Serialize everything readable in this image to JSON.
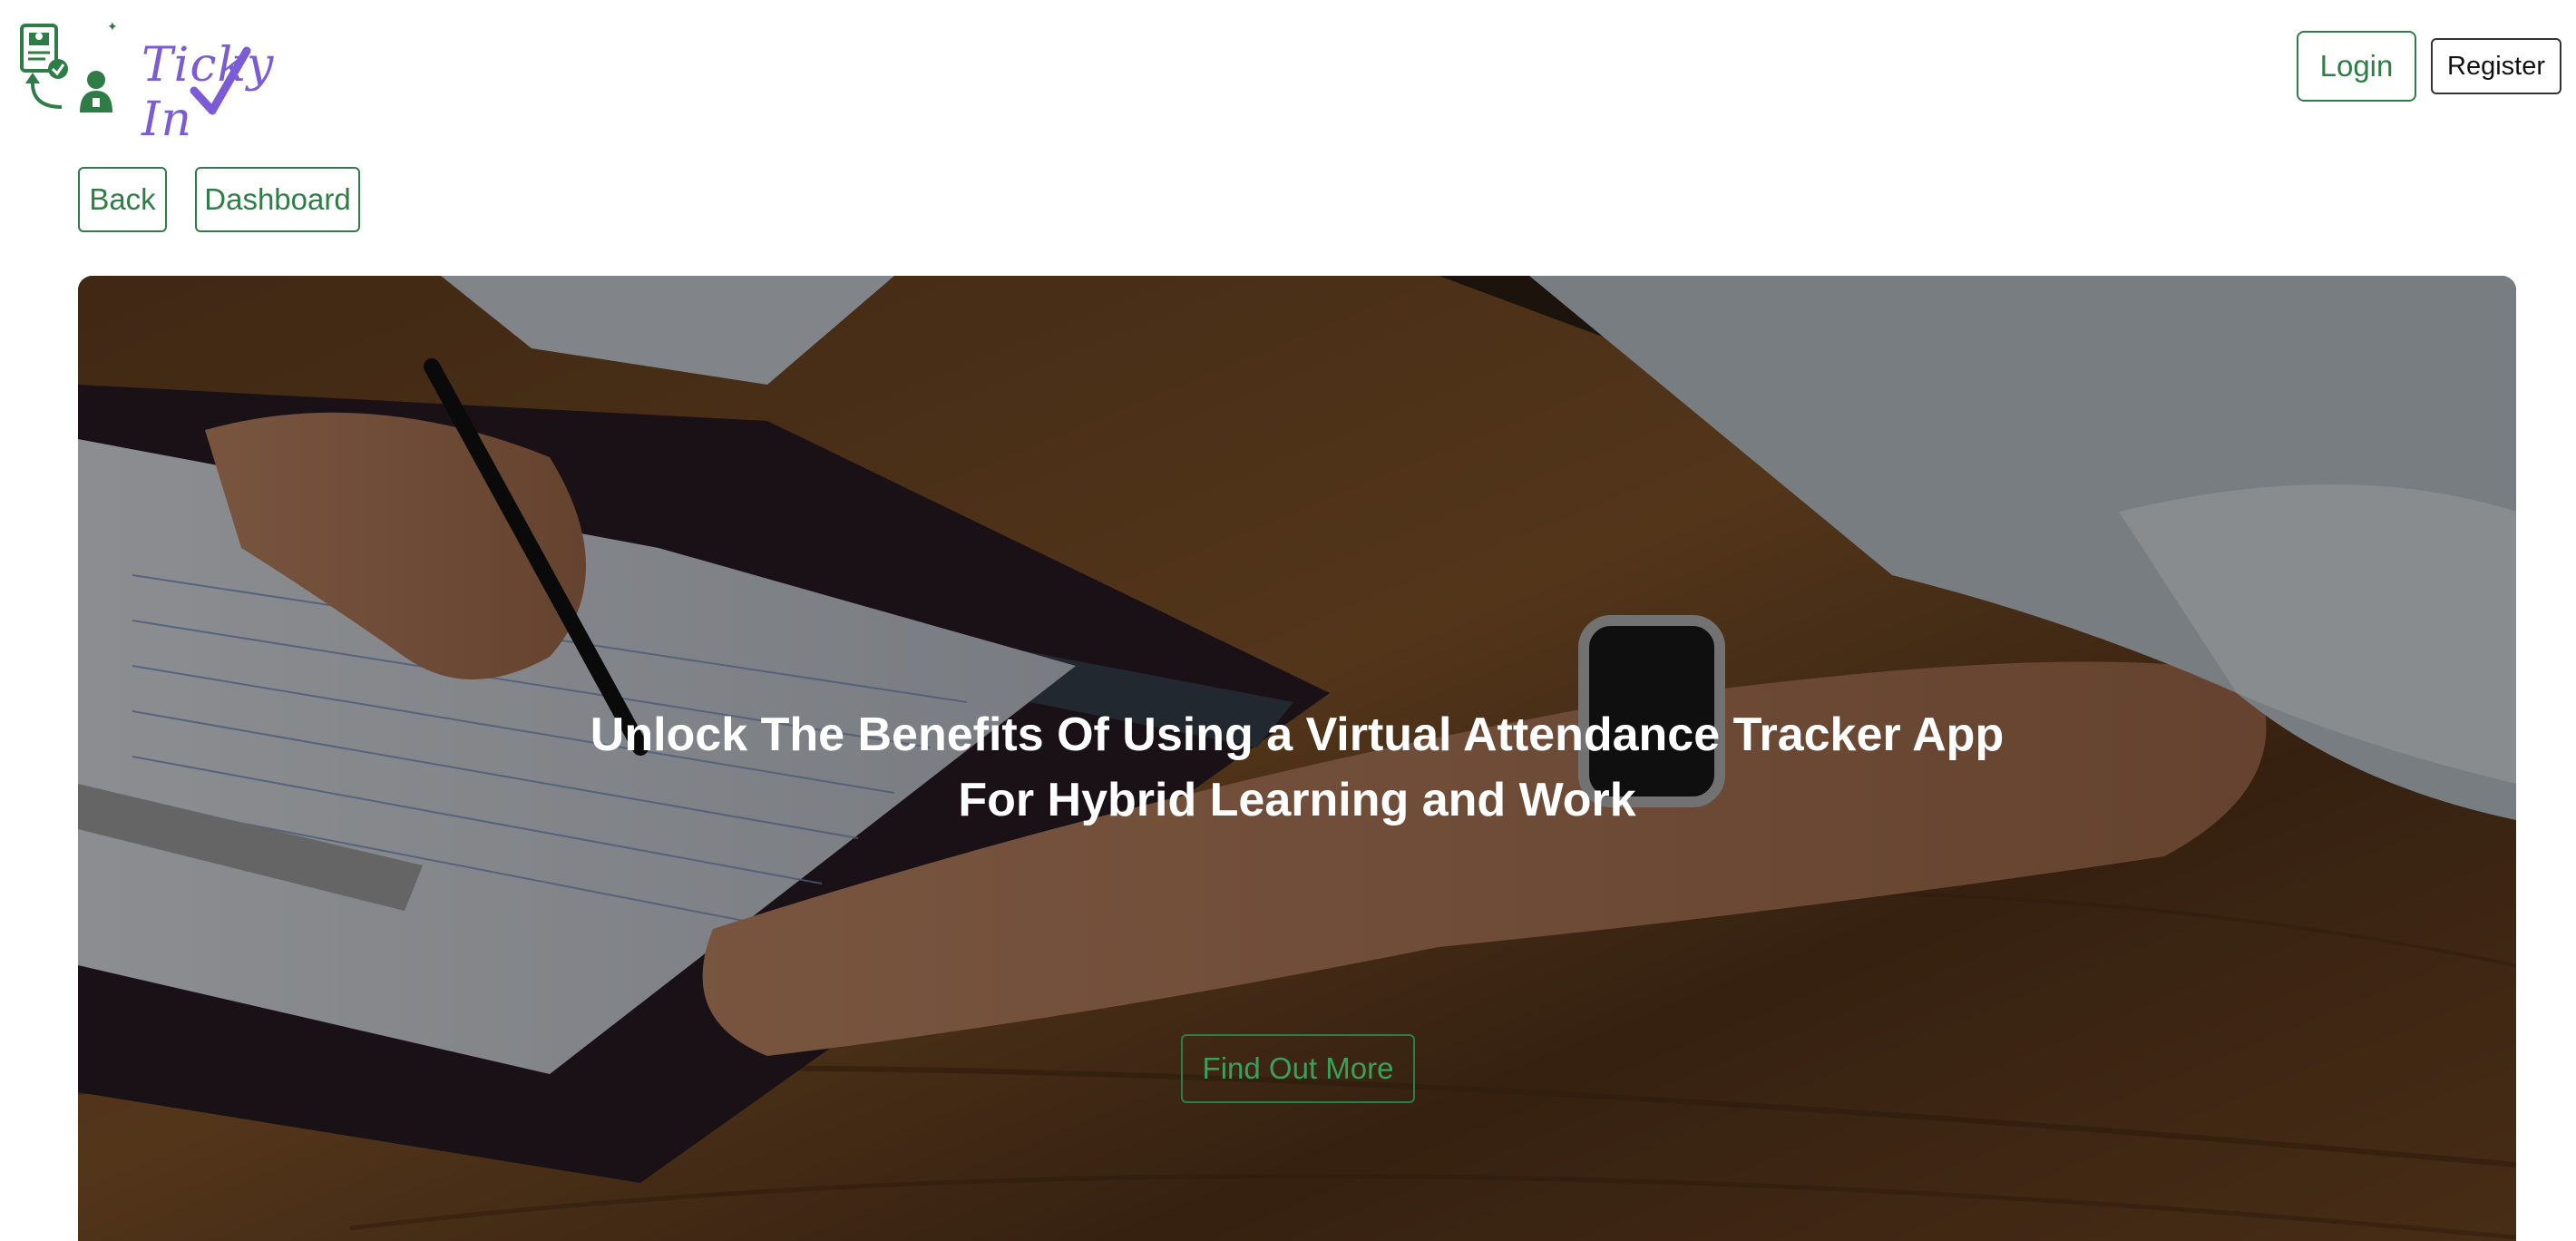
{
  "brand": {
    "logo_text": "Ticky In"
  },
  "header": {
    "login_label": "Login",
    "register_label": "Register"
  },
  "nav": {
    "back_label": "Back",
    "dashboard_label": "Dashboard"
  },
  "hero": {
    "title_line1": "Unlock The Benefits Of Using a Virtual Attendance Tracker App",
    "title_line2": "For Hybrid Learning and Work",
    "cta_label": "Find Out More"
  },
  "colors": {
    "accent_green": "#2e7d46",
    "logo_purple": "#7b5cd6",
    "hero_text": "#ffffff"
  }
}
